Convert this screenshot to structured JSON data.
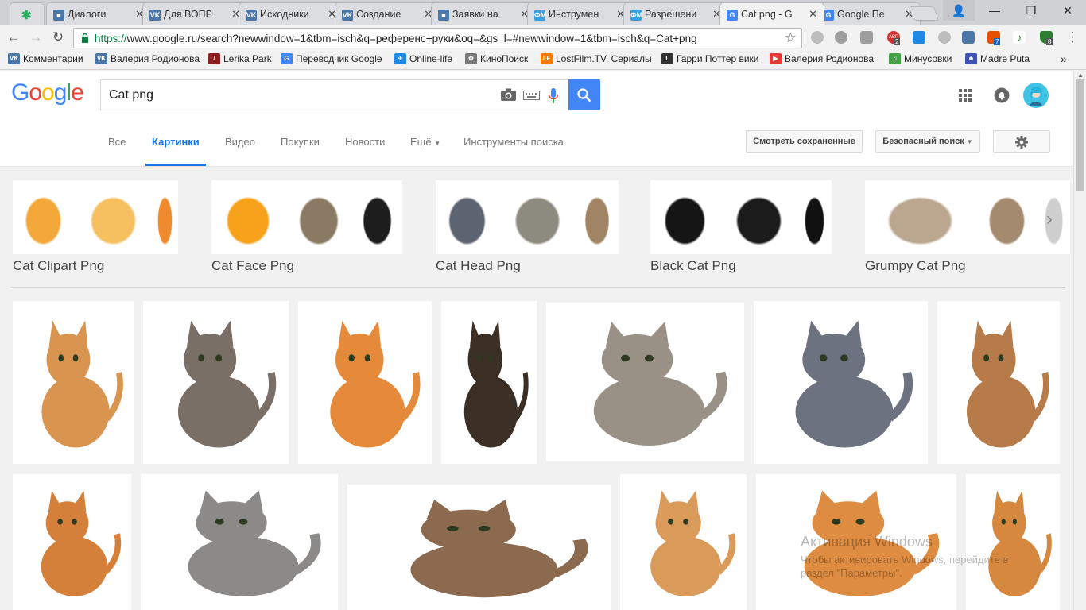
{
  "browser": {
    "tabs": [
      {
        "label": "Диалоги",
        "icon": "vk-message-icon",
        "color": "#4a76a8",
        "glyph": "■"
      },
      {
        "label": "Для ВОПР",
        "icon": "vk-icon",
        "color": "#4a76a8",
        "glyph": "VK"
      },
      {
        "label": "Исходники",
        "icon": "vk-icon",
        "color": "#4a76a8",
        "glyph": "VK"
      },
      {
        "label": "Создание",
        "icon": "vk-icon",
        "color": "#4a76a8",
        "glyph": "VK"
      },
      {
        "label": "Заявки на",
        "icon": "vk-message-icon",
        "color": "#4a76a8",
        "glyph": "■"
      },
      {
        "label": "Инструмен",
        "icon": "fm-icon",
        "color": "#39a0e0",
        "glyph": "ФМ"
      },
      {
        "label": "Разрешени",
        "icon": "fm-icon",
        "color": "#39a0e0",
        "glyph": "ФМ"
      },
      {
        "label": "Cat png - G",
        "icon": "google-icon",
        "color": "#4285f4",
        "glyph": "G"
      },
      {
        "label": "Google Пе",
        "icon": "google-translate-icon",
        "color": "#4285f4",
        "glyph": "G"
      }
    ],
    "window_controls": {
      "user": "👤",
      "minimize": "—",
      "maximize": "❐",
      "close": "✕"
    },
    "url_https": "https://",
    "url_rest": "www.google.ru/search?newwindow=1&tbm=isch&q=референс+руки&oq=&gs_l=#newwindow=1&tbm=isch&q=Cat+png",
    "extension_badges": {
      "abp": "2",
      "vk_badge": "7",
      "shield_badge": "8"
    },
    "bookmarks_more": "»",
    "bookmarks": [
      {
        "label": "Комментарии",
        "color": "#4a76a8",
        "glyph": "VK"
      },
      {
        "label": "Валерия Родионова",
        "color": "#4a76a8",
        "glyph": "VK"
      },
      {
        "label": "Lerika Park",
        "color": "#8b1e1e",
        "glyph": "/"
      },
      {
        "label": "Переводчик Google",
        "color": "#4285f4",
        "glyph": "G"
      },
      {
        "label": "Online-life",
        "color": "#1e88e5",
        "glyph": "✈"
      },
      {
        "label": "КиноПоиск",
        "color": "#777777",
        "glyph": "✿"
      },
      {
        "label": "LostFilm.TV. Сериалы",
        "color": "#f57c00",
        "glyph": "LF"
      },
      {
        "label": "Гарри Поттер вики",
        "color": "#333333",
        "glyph": "Г"
      },
      {
        "label": "Валерия Родионова",
        "color": "#e53935",
        "glyph": "▶"
      },
      {
        "label": "Минусовки",
        "color": "#43a047",
        "glyph": "♫"
      },
      {
        "label": "Madre Puta",
        "color": "#3f51b5",
        "glyph": "☻"
      }
    ]
  },
  "google": {
    "logo": [
      "G",
      "o",
      "o",
      "g",
      "l",
      "e"
    ],
    "logo_colors": [
      "#4285f4",
      "#ea4335",
      "#fbbc05",
      "#4285f4",
      "#34a853",
      "#ea4335"
    ],
    "query": "Cat png",
    "nav_tabs": [
      "Все",
      "Картинки",
      "Видео",
      "Покупки",
      "Новости",
      "Ещё",
      "Инструменты поиска"
    ],
    "selected_tab": "Картинки",
    "saved_button": "Смотреть сохраненные",
    "safesearch_button": "Безопасный поиск"
  },
  "related": [
    {
      "label": "Cat Clipart Png",
      "thumbs": [
        "#f4a83a",
        "#f6c060",
        "#ef8a2e"
      ]
    },
    {
      "label": "Cat Face Png",
      "thumbs": [
        "#f8a11b",
        "#8a7a63",
        "#1d1d1d"
      ]
    },
    {
      "label": "Cat Head Png",
      "thumbs": [
        "#5b6470",
        "#8d8a80",
        "#a08464"
      ]
    },
    {
      "label": "Black Cat Png",
      "thumbs": [
        "#151515",
        "#1b1b1b",
        "#111111"
      ]
    },
    {
      "label": "Grumpy Cat Png",
      "thumbs": [
        "#bba68f",
        "#a48a6f",
        "#cfcfcf"
      ]
    }
  ],
  "results": [
    {
      "name": "ginger-kitten-standing",
      "color": "#d99450"
    },
    {
      "name": "tabby-kitten-lying",
      "color": "#7a6f66"
    },
    {
      "name": "orange-kitten-walking",
      "color": "#e58a3a"
    },
    {
      "name": "calico-cat-standing",
      "color": "#3a2e25"
    },
    {
      "name": "fluffy-grey-cat-sitting",
      "color": "#9a9186"
    },
    {
      "name": "grey-british-cat-sitting",
      "color": "#6c7280"
    },
    {
      "name": "fluffy-kitten-sitting",
      "color": "#b67b48"
    },
    {
      "name": "orange-cat-sitting",
      "color": "#d5803a"
    },
    {
      "name": "grey-slim-cat-standing",
      "color": "#8b8a88"
    },
    {
      "name": "tabby-cat-stretching",
      "color": "#8c6a4f"
    },
    {
      "name": "orange-kitten-portrait",
      "color": "#d99a5a"
    },
    {
      "name": "fluffy-orange-kitten",
      "color": "#dd8c42"
    },
    {
      "name": "orange-kitten-playing",
      "color": "#d7883f"
    }
  ],
  "relnext": "›",
  "watermark": {
    "line1": "Активация Windows",
    "line2": "Чтобы активировать Windows, перейдите в",
    "line3": "раздел \"Параметры\"."
  }
}
